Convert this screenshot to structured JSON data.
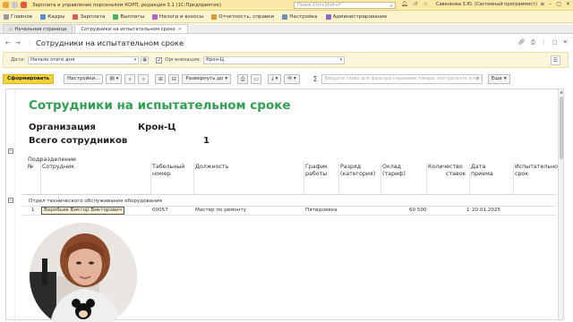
{
  "titlebar": {
    "app_title": "Зарплата и управление персоналом КОРП, редакция 3.1  (1С:Предприятие)",
    "search_placeholder": "Поиск Ctrl+Shift+F",
    "user": "Савенкова З.Ю. (Системный программист)"
  },
  "menu": {
    "items": [
      {
        "label": "Главное",
        "icon": "hamburger-icon"
      },
      {
        "label": "Кадры",
        "icon": "people-icon"
      },
      {
        "label": "Зарплата",
        "icon": "salary-icon"
      },
      {
        "label": "Выплаты",
        "icon": "payments-icon"
      },
      {
        "label": "Налоги и взносы",
        "icon": "taxes-icon"
      },
      {
        "label": "Отчетность, справки",
        "icon": "reports-icon"
      },
      {
        "label": "Настройка",
        "icon": "settings-icon"
      },
      {
        "label": "Администрирование",
        "icon": "admin-icon"
      }
    ]
  },
  "tabs": {
    "home": "Начальная страница",
    "active": "Сотрудники на испытательном сроке"
  },
  "form": {
    "title": "Сотрудники на испытательном сроке"
  },
  "filters": {
    "date_label": "Дата:",
    "date_value": "Начало этого дня",
    "org_label": "Организация:",
    "org_value": "Крон-Ц"
  },
  "toolbar": {
    "generate": "Сформировать",
    "settings": "Настройки...",
    "expand": "Развернуть до",
    "search_placeholder": "Введите слово для фильтра (название товара, контрагента и пр.)",
    "more": "Еще"
  },
  "report": {
    "title": "Сотрудники на испытательном сроке",
    "org_label": "Организация",
    "org_value": "Крон-Ц",
    "total_label": "Всего сотрудников",
    "total_value": "1",
    "subdivision_label": "Подразделение",
    "columns": {
      "num": "№",
      "employee": "Сотрудник",
      "tab_number_1": "Табельный",
      "tab_number_2": "номер",
      "position": "Должность",
      "schedule_1": "График",
      "schedule_2": "работы",
      "rank_1": "Разряд",
      "rank_2": "(категория)",
      "salary_1": "Оклад",
      "salary_2": "(тариф)",
      "rates_1": "Количество",
      "rates_2": "ставок",
      "hire_1": "Дата",
      "hire_2": "приема",
      "trial_1": "Испытательно",
      "trial_2": "срок"
    },
    "group": "Отдел технического обслуживания оборудования",
    "rows": [
      {
        "num": "1",
        "employee": "Воробьев Виктор Викторович",
        "tab_number": "00057",
        "position": "Мастер по ремонту",
        "schedule": "Пятидневка",
        "salary": "60 500",
        "rates": "1",
        "hire_date": "20.01.2025"
      }
    ]
  },
  "colors": {
    "titlebar_bg": "#fbe9a8",
    "menubar_bg": "#fdf3cf",
    "accent_button": "#f4d33d",
    "report_title": "#2f9f51"
  }
}
